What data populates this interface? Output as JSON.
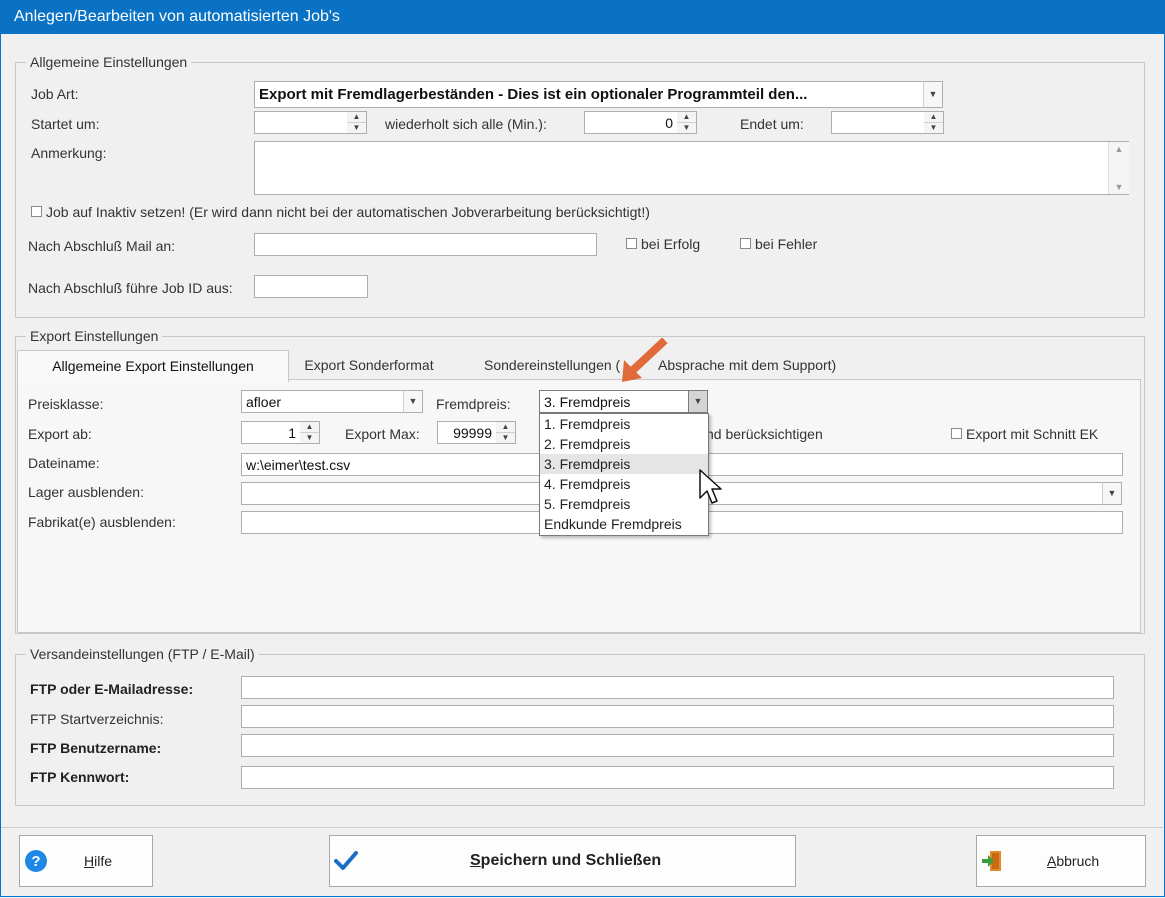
{
  "window": {
    "title": "Anlegen/Bearbeiten von automatisierten Job's"
  },
  "general": {
    "legend": "Allgemeine Einstellungen",
    "job_art_label": "Job Art:",
    "job_art_value": "Export mit Fremdlagerbeständen - Dies ist ein optionaler Programmteil den...",
    "startet_label": "Startet um:",
    "startet_value": "",
    "wiederholt_label": "wiederholt sich alle (Min.):",
    "wiederholt_value": "0",
    "endet_label": "Endet um:",
    "endet_value": "",
    "anmerkung_label": "Anmerkung:",
    "anmerkung_value": "",
    "inaktiv_label": "Job auf Inaktiv setzen! (Er wird dann nicht bei der automatischen Jobverarbeitung berücksichtigt!)",
    "mail_label": "Nach Abschluß Mail an:",
    "mail_value": "",
    "erfolg_label": "bei Erfolg",
    "fehler_label": "bei Fehler",
    "jobid_label": "Nach Abschluß führe Job ID aus:",
    "jobid_value": ""
  },
  "export": {
    "legend": "Export Einstellungen",
    "tabs": [
      {
        "label": "Allgemeine Export Einstellungen",
        "active": true
      },
      {
        "label": "Export Sonderformat",
        "active": false
      },
      {
        "label": "Sondereinstellungen (",
        "active": false
      },
      {
        "label": "Absprache mit dem Support)",
        "active": false
      }
    ],
    "preisklasse_label": "Preisklasse:",
    "preisklasse_value": "afloer",
    "fremdpreis_label": "Fremdpreis:",
    "fremdpreis_value": "3. Fremdpreis",
    "export_ab_label": "Export ab:",
    "export_ab_value": "1",
    "export_max_label": "Export Max:",
    "export_max_value": "99999",
    "hidden_text": "nd berücksichtigen",
    "schnitt_label": "Export mit Schnitt EK",
    "dateiname_label": "Dateiname:",
    "dateiname_value": "w:\\eimer\\test.csv",
    "lager_label": "Lager ausblenden:",
    "lager_value": "",
    "fabrikat_label": "Fabrikat(e) ausblenden:",
    "fabrikat_value": "",
    "fremdpreis_options": [
      "1. Fremdpreis",
      "2. Fremdpreis",
      "3. Fremdpreis",
      "4. Fremdpreis",
      "5. Fremdpreis",
      "Endkunde Fremdpreis"
    ],
    "fremdpreis_selected_index": 2
  },
  "versand": {
    "legend": "Versandeinstellungen (FTP / E-Mail)",
    "ftp_label": "FTP oder E-Mailadresse:",
    "ftp_value": "",
    "startverz_label": "FTP Startverzeichnis:",
    "startverz_value": "",
    "benutzer_label": "FTP Benutzername:",
    "benutzer_value": "",
    "kennwort_label": "FTP Kennwort:",
    "kennwort_value": ""
  },
  "buttons": {
    "hilfe_prefix": "H",
    "hilfe_rest": "ilfe",
    "speichern_prefix": "S",
    "speichern_rest": "peichern und Schließen",
    "abbruch_prefix": "A",
    "abbruch_rest": "bbruch"
  },
  "colors": {
    "titlebar": "#0a72c4",
    "arrow": "#e06a3a",
    "check": "#1a6fc4"
  }
}
